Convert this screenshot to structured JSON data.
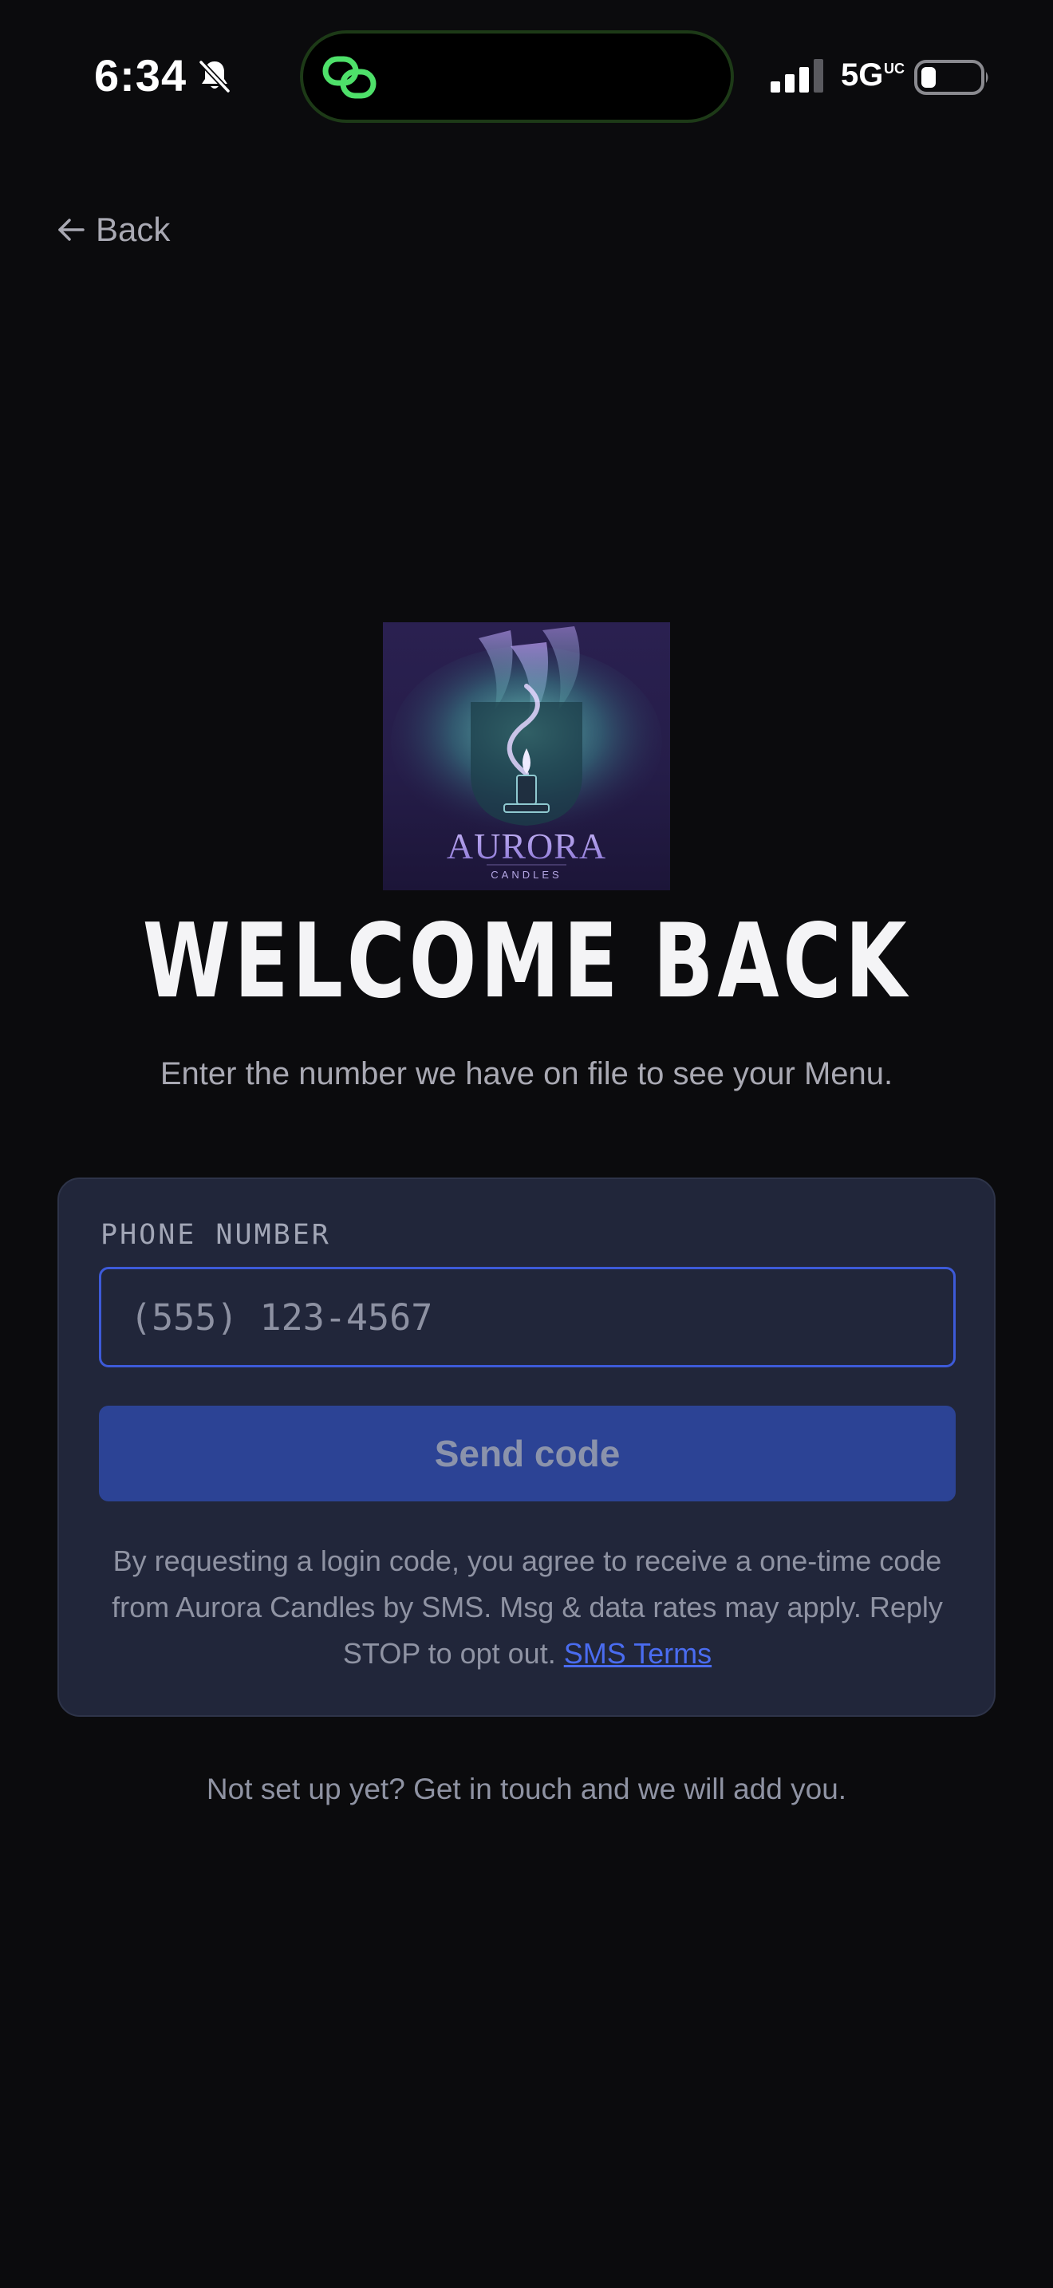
{
  "status_bar": {
    "time": "6:34",
    "network": "5G",
    "network_suffix": "UC"
  },
  "nav": {
    "back_label": "Back"
  },
  "logo": {
    "brand_name": "AURORA",
    "brand_sub": "CANDLES"
  },
  "hero": {
    "title": "WELCOME BACK",
    "subtitle": "Enter the number we have on file to see your Menu."
  },
  "form": {
    "phone_label": "PHONE NUMBER",
    "phone_placeholder": "(555) 123-4567",
    "phone_value": "",
    "submit_label": "Send code",
    "consent_text": "By requesting a login code, you agree to receive a one-time code from Aurora Candles by SMS. Msg & data rates may apply. Reply STOP to opt out.",
    "terms_link_label": "SMS Terms"
  },
  "footer": {
    "note": "Not set up yet? Get in touch and we will add you."
  },
  "colors": {
    "background": "#0b0b0d",
    "card": "#21263a",
    "accent": "#3d5ad8",
    "button": "#2c4395",
    "island_glow": "#4ee06a"
  }
}
